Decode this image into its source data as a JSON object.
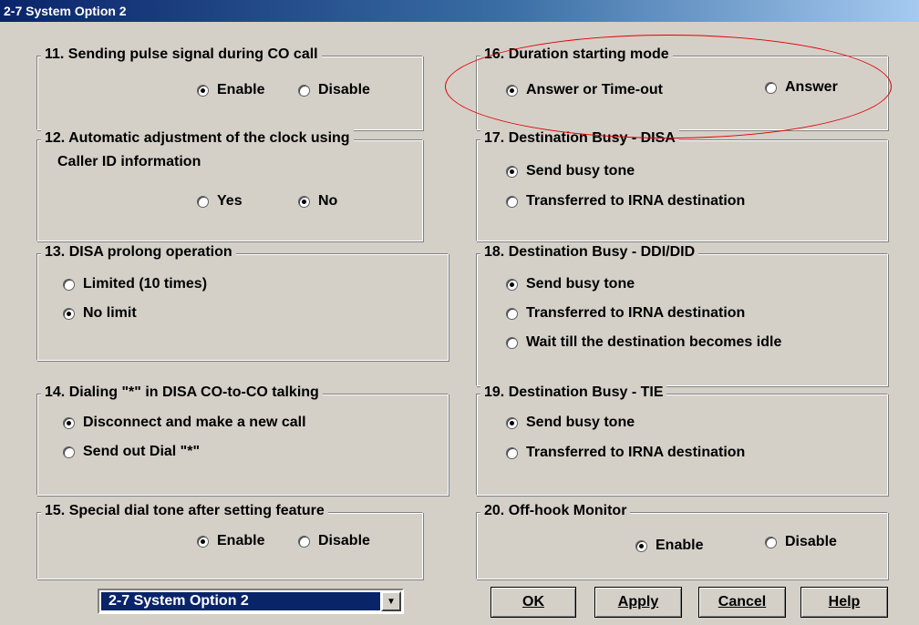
{
  "window": {
    "title": "2-7 System Option 2"
  },
  "groups": {
    "g11": {
      "title": "11. Sending pulse signal during CO call",
      "options": [
        {
          "label": "Enable",
          "selected": true
        },
        {
          "label": "Disable",
          "selected": false
        }
      ]
    },
    "g12": {
      "title": "12. Automatic adjustment of the clock using",
      "title2": "Caller ID information",
      "options": [
        {
          "label": "Yes",
          "selected": false
        },
        {
          "label": "No",
          "selected": true
        }
      ]
    },
    "g13": {
      "title": "13. DISA prolong operation",
      "options": [
        {
          "label": "Limited (10 times)",
          "selected": false
        },
        {
          "label": "No limit",
          "selected": true
        }
      ]
    },
    "g14": {
      "title": "14. Dialing \"*\" in DISA CO-to-CO talking",
      "options": [
        {
          "label": "Disconnect and make a new call",
          "selected": true
        },
        {
          "label": "Send out Dial \"*\"",
          "selected": false
        }
      ]
    },
    "g15": {
      "title": "15. Special dial tone after setting feature",
      "options": [
        {
          "label": "Enable",
          "selected": true
        },
        {
          "label": "Disable",
          "selected": false
        }
      ]
    },
    "g16": {
      "title": "16. Duration starting mode",
      "options": [
        {
          "label": "Answer or Time-out",
          "selected": true
        },
        {
          "label": "Answer",
          "selected": false
        }
      ]
    },
    "g17": {
      "title": "17. Destination Busy - DISA",
      "options": [
        {
          "label": "Send busy tone",
          "selected": true
        },
        {
          "label": "Transferred to IRNA destination",
          "selected": false
        }
      ]
    },
    "g18": {
      "title": "18. Destination Busy - DDI/DID",
      "options": [
        {
          "label": "Send busy tone",
          "selected": true
        },
        {
          "label": "Transferred to IRNA destination",
          "selected": false
        },
        {
          "label": "Wait till the destination becomes idle",
          "selected": false
        }
      ]
    },
    "g19": {
      "title": "19. Destination Busy - TIE",
      "options": [
        {
          "label": "Send busy tone",
          "selected": true
        },
        {
          "label": "Transferred to IRNA destination",
          "selected": false
        }
      ]
    },
    "g20": {
      "title": "20. Off-hook Monitor",
      "options": [
        {
          "label": "Enable",
          "selected": true
        },
        {
          "label": "Disable",
          "selected": false
        }
      ]
    }
  },
  "page_selector": {
    "value": "2-7 System Option 2",
    "arrow_icon": "dropdown-arrow-icon"
  },
  "buttons": {
    "ok": "OK",
    "apply": "Apply",
    "cancel": "Cancel",
    "help": "Help"
  },
  "annotation": {
    "color": "#e00000",
    "shape": "ellipse",
    "target": "16. Duration starting mode"
  }
}
